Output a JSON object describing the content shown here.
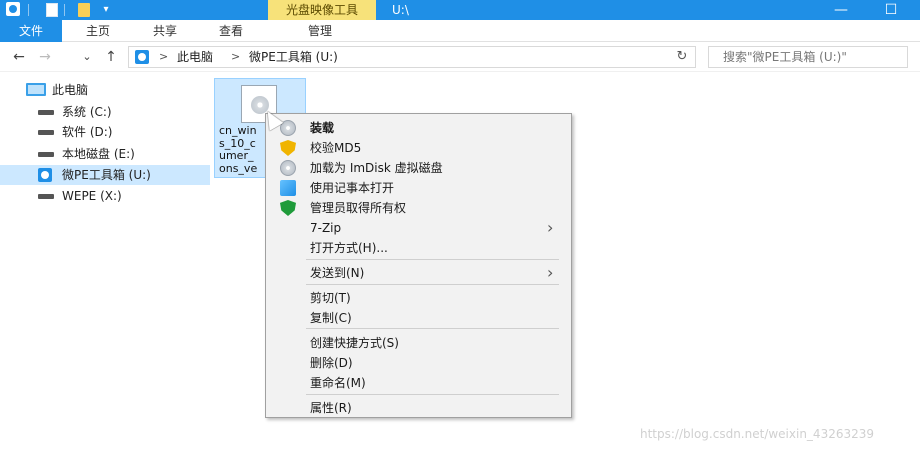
{
  "titlebar": {
    "context_tab": "光盘映像工具",
    "path": "U:\\",
    "dropdown_glyph": "▾",
    "minimize": "—",
    "maximize": "☐"
  },
  "ribbon": {
    "tabs": [
      "文件",
      "主页",
      "共享",
      "查看",
      "管理"
    ]
  },
  "address": {
    "back": "←",
    "forward": "→",
    "recent": "⌄",
    "up": "↑",
    "chevron": ">",
    "crumbs": [
      "此电脑",
      "微PE工具箱 (U:)"
    ],
    "refresh": "↻",
    "search_placeholder": "搜索\"微PE工具箱 (U:)\""
  },
  "navpane": {
    "items": [
      {
        "label": "此电脑",
        "icon": "pc-icon"
      },
      {
        "label": "系统 (C:)",
        "icon": "drive-icon"
      },
      {
        "label": "软件 (D:)",
        "icon": "drive-icon"
      },
      {
        "label": "本地磁盘 (E:)",
        "icon": "drive-icon"
      },
      {
        "label": "微PE工具箱 (U:)",
        "icon": "disc-drive-icon",
        "selected": true
      },
      {
        "label": "WEPE (X:)",
        "icon": "drive-icon"
      }
    ]
  },
  "file": {
    "name_visible": "cn_win\ns_10_c\numer_\nons_ve"
  },
  "context_menu": {
    "items": [
      {
        "label": "装载",
        "icon": "disc-icon",
        "bold": true
      },
      {
        "label": "校验MD5",
        "icon": "shield-yellow-icon"
      },
      {
        "label": "加载为 ImDisk 虚拟磁盘",
        "icon": "disc-icon"
      },
      {
        "label": "使用记事本打开",
        "icon": "notepad-icon"
      },
      {
        "label": "管理员取得所有权",
        "icon": "shield-green-icon"
      },
      {
        "label": "7-Zip",
        "submenu": true
      },
      {
        "label": "打开方式(H)..."
      },
      {
        "label": "发送到(N)",
        "submenu": true
      },
      {
        "label": "剪切(T)"
      },
      {
        "label": "复制(C)"
      },
      {
        "label": "创建快捷方式(S)"
      },
      {
        "label": "删除(D)"
      },
      {
        "label": "重命名(M)"
      },
      {
        "label": "属性(R)"
      }
    ],
    "submenu_arrow": "›"
  },
  "watermark": "https://blog.csdn.net/weixin_43263239"
}
